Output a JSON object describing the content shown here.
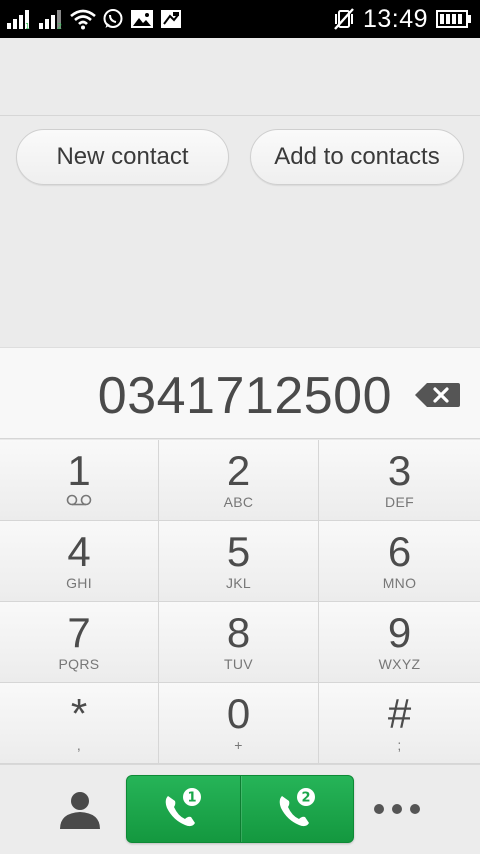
{
  "status_bar": {
    "time": "13:49",
    "sim1_label": "1",
    "sim2_label": "2",
    "icons": [
      "signal-sim1-icon",
      "signal-sim2-icon",
      "wifi-icon",
      "whatsapp-icon",
      "gallery-icon",
      "screenshot-icon",
      "vibrate-icon",
      "battery-icon"
    ]
  },
  "actions": {
    "new_contact": "New contact",
    "add_to_contacts": "Add to contacts"
  },
  "dialer": {
    "number": "0341712500"
  },
  "keypad": [
    {
      "digit": "1",
      "letters": ""
    },
    {
      "digit": "2",
      "letters": "ABC"
    },
    {
      "digit": "3",
      "letters": "DEF"
    },
    {
      "digit": "4",
      "letters": "GHI"
    },
    {
      "digit": "5",
      "letters": "JKL"
    },
    {
      "digit": "6",
      "letters": "MNO"
    },
    {
      "digit": "7",
      "letters": "PQRS"
    },
    {
      "digit": "8",
      "letters": "TUV"
    },
    {
      "digit": "9",
      "letters": "WXYZ"
    },
    {
      "digit": "*",
      "letters": ","
    },
    {
      "digit": "0",
      "letters": "+"
    },
    {
      "digit": "#",
      "letters": ";"
    }
  ],
  "bottom": {
    "call_sim1_badge": "1",
    "call_sim2_badge": "2"
  },
  "colors": {
    "call_green": "#1aa64a",
    "status_bar_bg": "#000000"
  }
}
